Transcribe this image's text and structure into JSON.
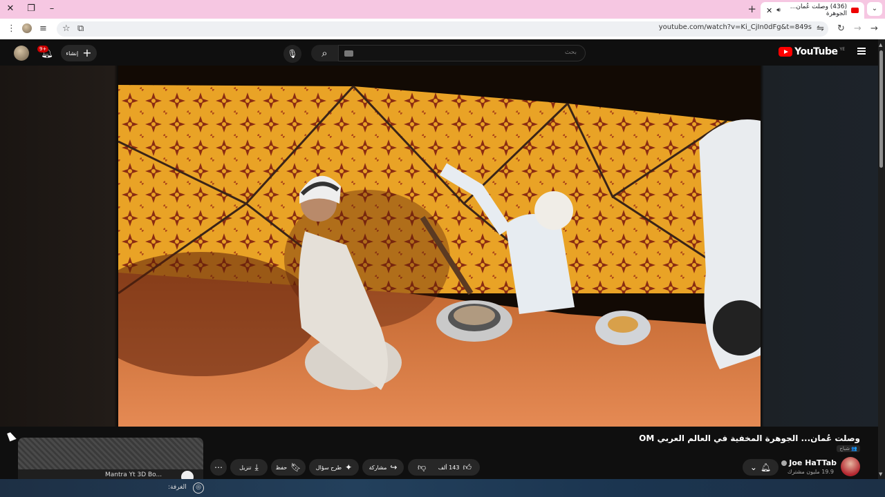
{
  "browser": {
    "tab_title": "(436) وصلت عُمان... الجوهرة",
    "url": "youtube.com/watch?v=Ki_CjIn0dFg&t=849s"
  },
  "masthead": {
    "logo_text": "YouTube",
    "country_code": "YE",
    "search_placeholder": "بحث",
    "create_label": "إنشاء",
    "notification_badge": "9+"
  },
  "video": {
    "title": "وصلت عُمان... الجوهرة المخفية في العالم العربي OM",
    "member_tag": "شباح",
    "channel_name": "Joe HaTTab",
    "subscribers": "19.9 مليون مشترك",
    "likes": "143 ألف",
    "share_label": "مشاركة",
    "ask_label": "طرح سؤال",
    "save_label": "حفظ",
    "download_label": "تنزيل"
  },
  "miniplayer": {
    "caption": "Mantra Yt 3D Bo..."
  },
  "taskbar": {
    "room_label": "الغرفة:"
  },
  "colors": {
    "accent": "#ff0000",
    "background": "#0f0f0f",
    "tab_strip": "#f6c7e2"
  }
}
